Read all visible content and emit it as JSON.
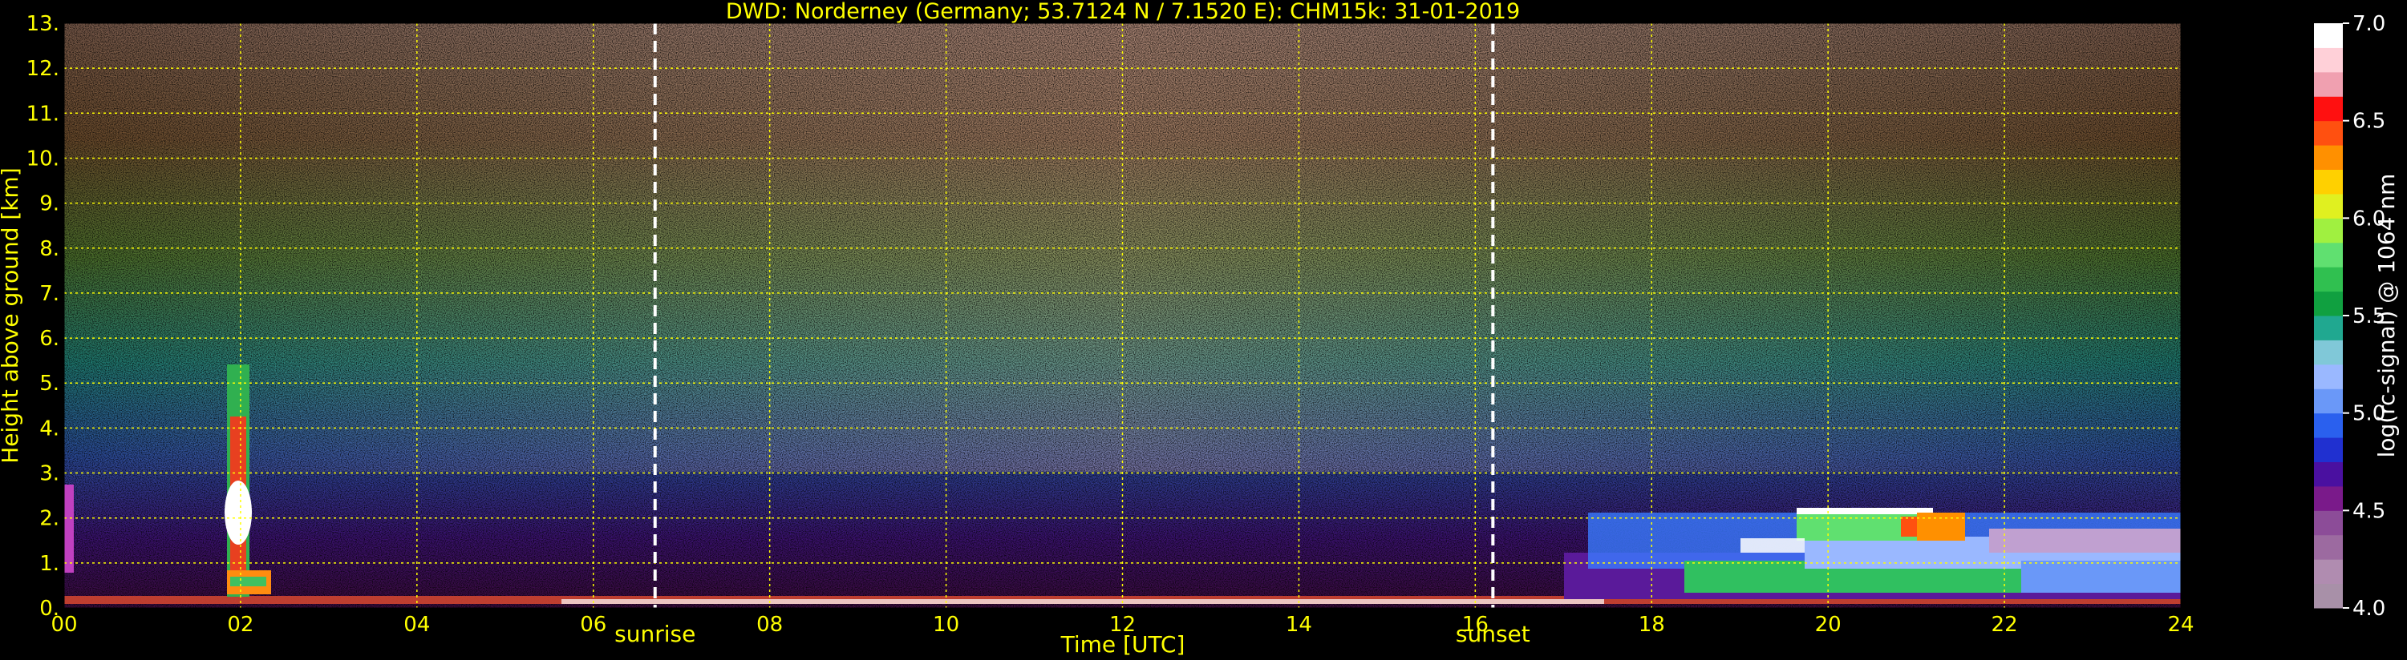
{
  "chart_data": {
    "type": "heatmap",
    "title": "DWD: Norderney (Germany; 53.7124 N / 7.1520 E):    CHM15k: 31-01-2019",
    "xlabel": "Time [UTC]",
    "ylabel": "Height above ground [km]",
    "xlim": [
      0,
      24
    ],
    "ylim": [
      0,
      13
    ],
    "x_ticks": [
      "00",
      "02",
      "04",
      "06",
      "08",
      "10",
      "12",
      "14",
      "16",
      "18",
      "20",
      "22",
      "24"
    ],
    "y_ticks": [
      "0.",
      "1.",
      "2.",
      "3.",
      "4.",
      "5.",
      "6.",
      "7.",
      "8.",
      "9.",
      "10.",
      "11.",
      "12.",
      "13."
    ],
    "grid": true,
    "annotations": [
      {
        "label": "sunrise",
        "x": 6.7
      },
      {
        "label": "sunset",
        "x": 16.2
      }
    ],
    "colorbar": {
      "label": "log(rc-signal) @ 1064 nm",
      "range": [
        4.0,
        7.0
      ],
      "ticks": [
        "4.0",
        "4.5",
        "5.0",
        "5.5",
        "6.0",
        "6.5",
        "7.0"
      ],
      "colors": [
        "#a890a8",
        "#b08cb0",
        "#9c6aa0",
        "#8c4c98",
        "#7a1a8a",
        "#4a10a0",
        "#2030d0",
        "#2a60ee",
        "#6a98f8",
        "#9ab8ff",
        "#80c8d8",
        "#20a890",
        "#10a040",
        "#30c050",
        "#60e070",
        "#a0f040",
        "#e0f020",
        "#ffd000",
        "#ff9000",
        "#ff5010",
        "#ff1010",
        "#f0a0b0",
        "#ffd0d8",
        "#ffffff"
      ]
    },
    "features": [
      {
        "name": "low cloud/precip column",
        "x": [
          1.75,
          2.15
        ],
        "y": [
          0.1,
          5.4
        ]
      },
      {
        "name": "boundary layer aerosol",
        "x": [
          0,
          24
        ],
        "y": [
          0,
          0.25
        ]
      },
      {
        "name": "stratocumulus layer",
        "x": [
          17.0,
          24.0
        ],
        "y": [
          0.2,
          2.0
        ]
      }
    ]
  }
}
